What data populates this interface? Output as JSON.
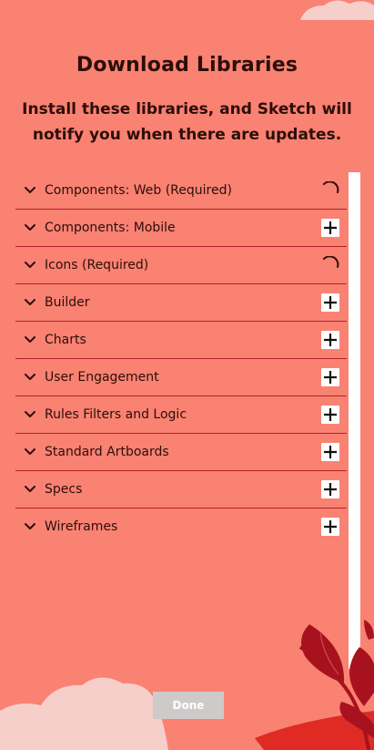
{
  "dialog": {
    "title": "Download Libraries",
    "subtitle": "Install these libraries, and Sketch will notify you when there are updates."
  },
  "libraries": [
    {
      "label": "Components: Web (Required)",
      "status": "loading",
      "icon": "spinner-icon"
    },
    {
      "label": "Components: Mobile",
      "status": "add",
      "icon": "plus-icon"
    },
    {
      "label": "Icons (Required)",
      "status": "loading",
      "icon": "spinner-icon"
    },
    {
      "label": "Builder",
      "status": "add",
      "icon": "plus-icon"
    },
    {
      "label": "Charts",
      "status": "add",
      "icon": "plus-icon"
    },
    {
      "label": "User Engagement",
      "status": "add",
      "icon": "plus-icon"
    },
    {
      "label": "Rules Filters and Logic",
      "status": "add",
      "icon": "plus-icon"
    },
    {
      "label": "Standard Artboards",
      "status": "add",
      "icon": "plus-icon"
    },
    {
      "label": "Specs",
      "status": "add",
      "icon": "plus-icon"
    },
    {
      "label": "Wireframes",
      "status": "add",
      "icon": "plus-icon"
    }
  ],
  "footer": {
    "done_label": "Done"
  },
  "colors": {
    "background": "#f98272",
    "divider": "#b8202a",
    "text": "#2c0e0a",
    "done_button_bg": "#cfcaca",
    "leaf_dark": "#a8121f",
    "leaf_red": "#e02b25",
    "cloud": "#f6cfcb"
  }
}
